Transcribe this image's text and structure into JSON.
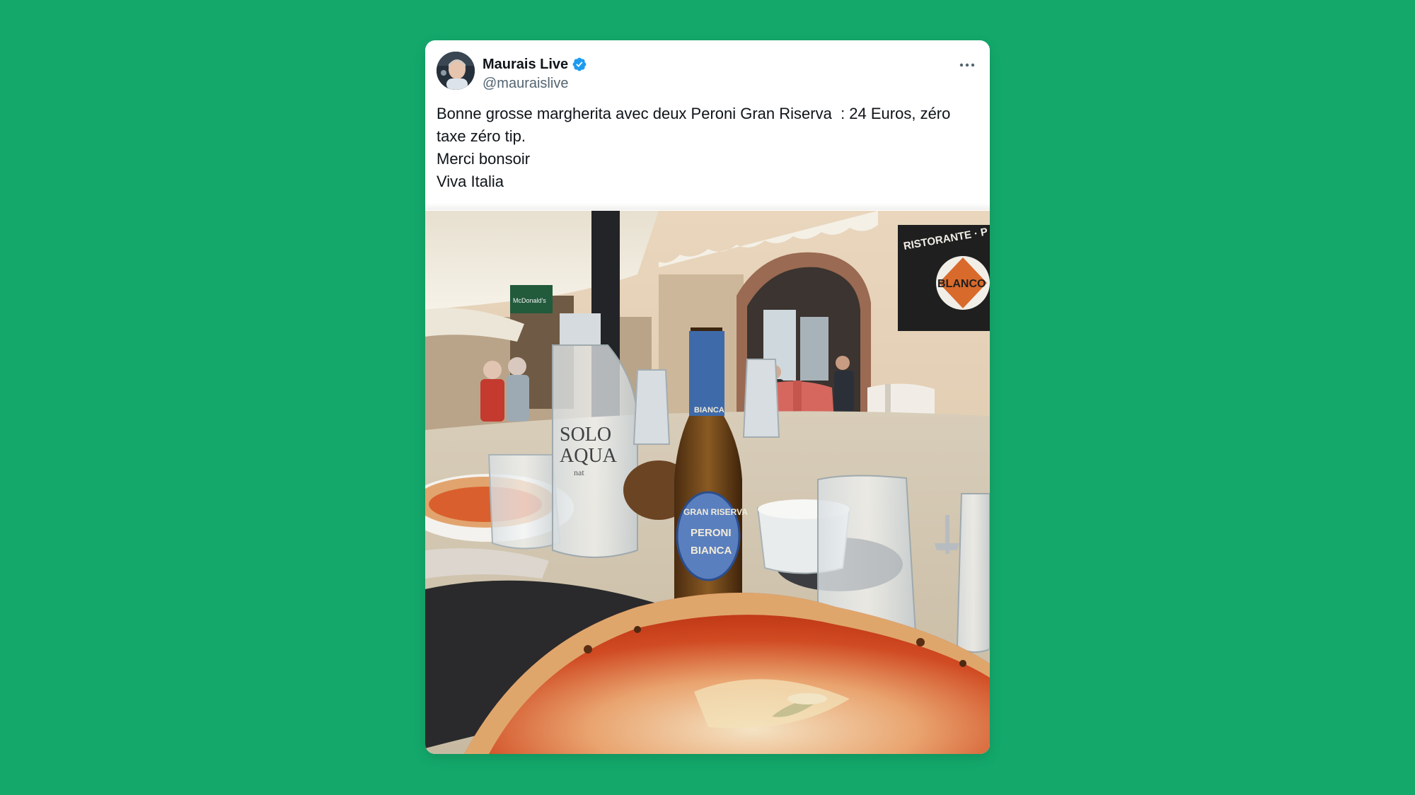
{
  "tweet": {
    "author": {
      "display_name": "Maurais Live",
      "handle": "@mauraislive",
      "verified": true
    },
    "text_lines": [
      "Bonne grosse margherita avec deux Peroni Gran Riserva  : 24 Euros, zéro",
      "taxe zéro tip.",
      "Merci bonsoir",
      "Viva Italia"
    ],
    "more_icon": "ellipsis-icon",
    "photo": {
      "signs": {
        "ristorante": "RISTORANTE · P",
        "blanco": "BLANCO",
        "mcdonalds": "McDonald's"
      },
      "bottles": {
        "water_brand_line1": "SOLO",
        "water_brand_line2": "AQUA",
        "water_sub": "nat",
        "beer_line1": "GRAN RISERVA",
        "beer_line2": "PERONI",
        "beer_line3": "BIANCA",
        "beer_neck_text": "BIANCA"
      }
    }
  },
  "colors": {
    "background": "#14a86b",
    "verified_badge": "#1d9bf0",
    "text_primary": "#0f1419",
    "text_secondary": "#536471"
  }
}
